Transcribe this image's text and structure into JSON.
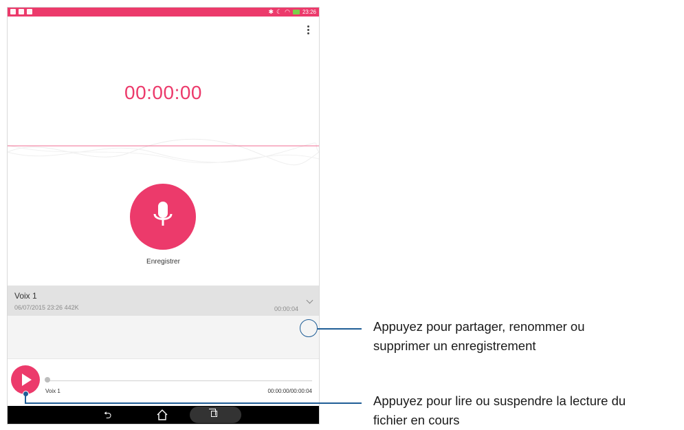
{
  "status_bar": {
    "time": "23:26",
    "accent_color": "#ec3a6b"
  },
  "recorder": {
    "timer": "00:00:00",
    "record_label": "Enregistrer"
  },
  "recording_item": {
    "title": "Voix 1",
    "meta": "06/07/2015 23:26   442K",
    "duration": "00:00:04"
  },
  "player": {
    "title": "Voix 1",
    "time": "00:00:00/00:00:04",
    "progress": 0
  },
  "annotations": {
    "options_line1": "Appuyez pour partager, renommer ou",
    "options_line2": "supprimer un enregistrement",
    "play_line1": "Appuyez pour lire ou suspendre la lecture du",
    "play_line2": "fichier en cours"
  },
  "icons": [
    "menu-icon",
    "mic-icon",
    "play-icon",
    "chevron-down-icon",
    "back-icon",
    "home-icon",
    "recent-apps-icon",
    "bluetooth-icon",
    "wifi-icon",
    "battery-icon"
  ]
}
